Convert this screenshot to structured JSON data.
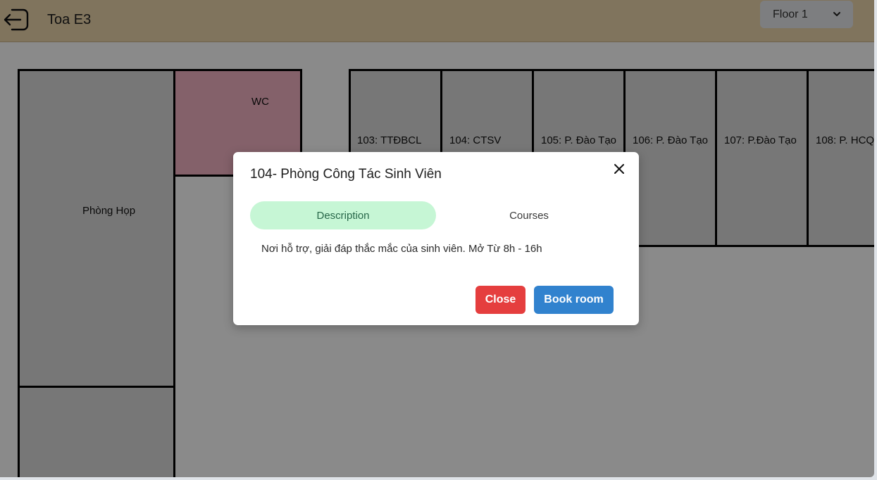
{
  "header": {
    "title": "Toa E3",
    "back_icon": "arrow-left-exit-icon",
    "floor_select": {
      "value": "Floor 1",
      "icon": "chevron-down-icon"
    }
  },
  "rooms": {
    "phong_hop": "Phòng Họp",
    "wc": "WC",
    "r103": "103: TTĐBCL",
    "r104": "104: CTSV",
    "r105": "105: P. Đào Tạo",
    "r106": "106: P. Đào Tạo",
    "r107": "107: P.Đào Tạo",
    "r108": "108: P. HCQ"
  },
  "modal": {
    "title": "104- Phòng Công Tác Sinh Viên",
    "close_icon": "close-icon",
    "tabs": [
      {
        "label": "Description",
        "active": true
      },
      {
        "label": "Courses",
        "active": false
      }
    ],
    "description": "Nơi hỗ trợ, giải đáp thắc mắc của sinh viên. Mở Từ 8h - 16h",
    "close_button": "Close",
    "book_button": "Book room"
  },
  "colors": {
    "header_bg": "#ecd6ad",
    "room_bg": "#dcdcdc",
    "wc_bg": "#f4b4c4",
    "tab_active_bg": "#c6f6d5",
    "tab_active_text": "#276749",
    "close_button_bg": "#e53e3e",
    "book_button_bg": "#3182ce"
  }
}
